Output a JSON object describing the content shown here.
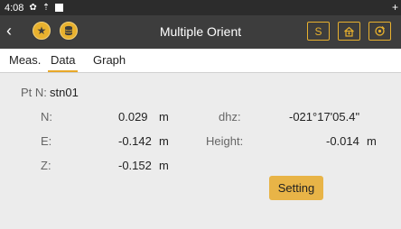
{
  "status_bar": {
    "time": "4:08"
  },
  "app_bar": {
    "title": "Multiple Orient",
    "s_button_label": "S"
  },
  "tabs": [
    {
      "label": "Meas."
    },
    {
      "label": "Data"
    },
    {
      "label": "Graph"
    }
  ],
  "point": {
    "label": "Pt N:",
    "value": "stn01"
  },
  "rows": {
    "n": {
      "label": "N:",
      "value": "0.029",
      "unit": "m"
    },
    "e": {
      "label": "E:",
      "value": "-0.142",
      "unit": "m"
    },
    "z": {
      "label": "Z:",
      "value": "-0.152",
      "unit": "m"
    },
    "dhz": {
      "label": "dhz:",
      "value": "-021°17'05.4\""
    },
    "height": {
      "label": "Height:",
      "value": "-0.014",
      "unit": "m"
    }
  },
  "setting_button": {
    "label": "Setting"
  },
  "colors": {
    "accent": "#e8b12e",
    "appbar": "#3d3d3d",
    "statusbar": "#2c2c2c"
  }
}
